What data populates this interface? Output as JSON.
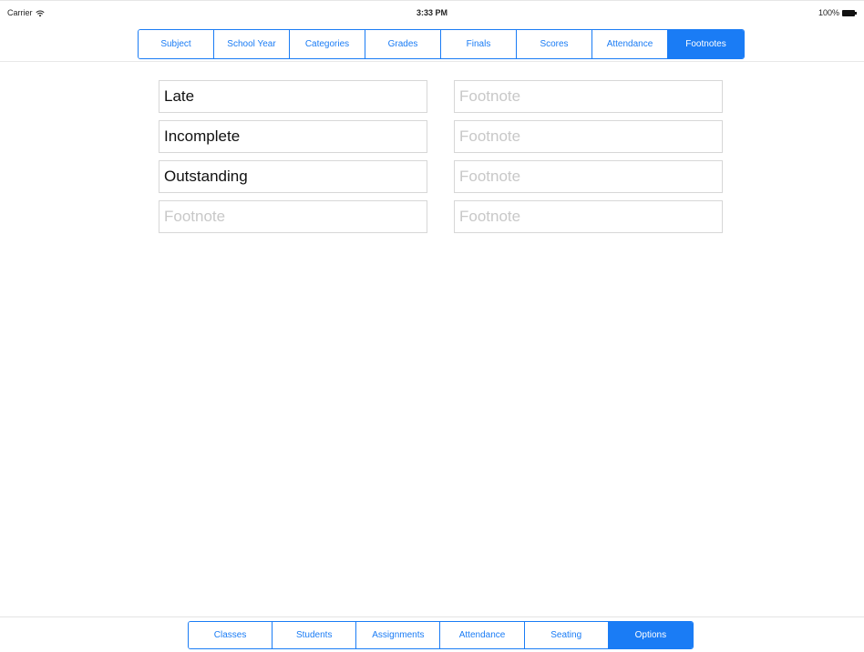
{
  "status_bar": {
    "carrier": "Carrier",
    "time": "3:33 PM",
    "battery": "100%"
  },
  "top_tabs": {
    "items": [
      {
        "label": "Subject",
        "selected": false
      },
      {
        "label": "School Year",
        "selected": false
      },
      {
        "label": "Categories",
        "selected": false
      },
      {
        "label": "Grades",
        "selected": false
      },
      {
        "label": "Finals",
        "selected": false
      },
      {
        "label": "Scores",
        "selected": false
      },
      {
        "label": "Attendance",
        "selected": false
      },
      {
        "label": "Footnotes",
        "selected": true
      }
    ]
  },
  "footnotes": {
    "placeholder": "Footnote",
    "left": [
      {
        "value": "Late"
      },
      {
        "value": "Incomplete"
      },
      {
        "value": "Outstanding"
      },
      {
        "value": ""
      }
    ],
    "right": [
      {
        "value": ""
      },
      {
        "value": ""
      },
      {
        "value": ""
      },
      {
        "value": ""
      }
    ]
  },
  "bottom_tabs": {
    "items": [
      {
        "label": "Classes",
        "selected": false
      },
      {
        "label": "Students",
        "selected": false
      },
      {
        "label": "Assignments",
        "selected": false
      },
      {
        "label": "Attendance",
        "selected": false
      },
      {
        "label": "Seating",
        "selected": false
      },
      {
        "label": "Options",
        "selected": true
      }
    ]
  },
  "colors": {
    "accent": "#1a7cf5",
    "placeholder": "#c8c8c8",
    "field_border": "#d7d7d7"
  }
}
